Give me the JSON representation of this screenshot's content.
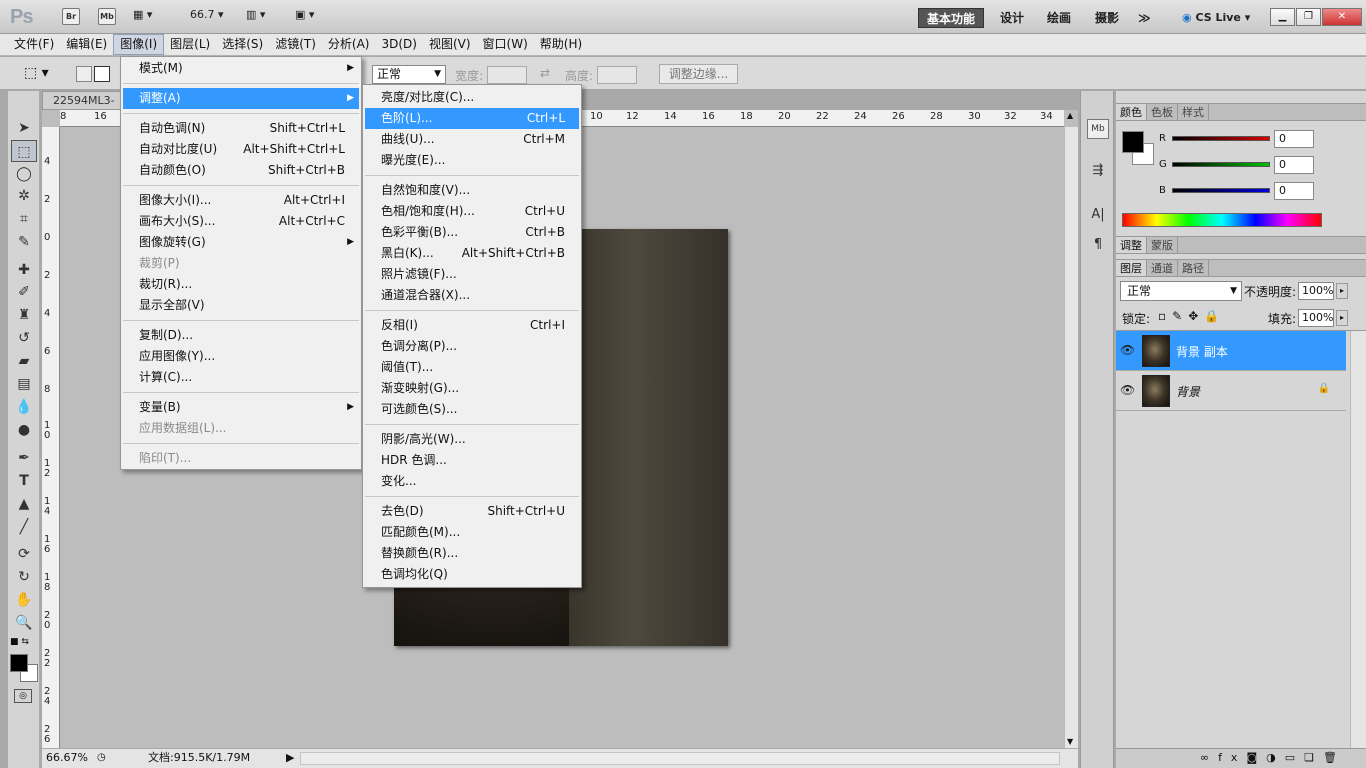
{
  "app": {
    "logo": "Ps",
    "bridge": "Br",
    "minibridge": "Mb",
    "zoom": "66.7",
    "workspaces": [
      "基本功能",
      "设计",
      "绘画",
      "摄影"
    ],
    "more": "≫",
    "cs_live": "CS Live"
  },
  "menubar": [
    "文件(F)",
    "编辑(E)",
    "图像(I)",
    "图层(L)",
    "选择(S)",
    "滤镜(T)",
    "分析(A)",
    "3D(D)",
    "视图(V)",
    "窗口(W)",
    "帮助(H)"
  ],
  "options": {
    "style": "正常",
    "width_label": "宽度:",
    "height_label": "高度:",
    "refine": "调整边缘..."
  },
  "document": {
    "tab": "22594ML3-",
    "ruler_top": [
      "8",
      "16",
      "10",
      "12",
      "14",
      "16",
      "18",
      "20",
      "22",
      "24",
      "26",
      "28",
      "30",
      "32",
      "34"
    ],
    "ruler_left": [
      "4",
      "2",
      "0",
      "2",
      "4",
      "6",
      "8",
      "10",
      "12",
      "14",
      "16",
      "18",
      "20",
      "22",
      "24",
      "26"
    ],
    "zoom_status": "66.67%",
    "file_info": "文档:915.5K/1.79M"
  },
  "image_menu": [
    {
      "label": "模式(M)",
      "submenu": true
    },
    {
      "sep": true
    },
    {
      "label": "调整(A)",
      "submenu": true,
      "highlight": true
    },
    {
      "sep": true
    },
    {
      "label": "自动色调(N)",
      "shortcut": "Shift+Ctrl+L"
    },
    {
      "label": "自动对比度(U)",
      "shortcut": "Alt+Shift+Ctrl+L"
    },
    {
      "label": "自动颜色(O)",
      "shortcut": "Shift+Ctrl+B"
    },
    {
      "sep": true
    },
    {
      "label": "图像大小(I)...",
      "shortcut": "Alt+Ctrl+I"
    },
    {
      "label": "画布大小(S)...",
      "shortcut": "Alt+Ctrl+C"
    },
    {
      "label": "图像旋转(G)",
      "submenu": true
    },
    {
      "label": "裁剪(P)",
      "disabled": true
    },
    {
      "label": "裁切(R)..."
    },
    {
      "label": "显示全部(V)"
    },
    {
      "sep": true
    },
    {
      "label": "复制(D)..."
    },
    {
      "label": "应用图像(Y)..."
    },
    {
      "label": "计算(C)..."
    },
    {
      "sep": true
    },
    {
      "label": "变量(B)",
      "submenu": true
    },
    {
      "label": "应用数据组(L)...",
      "disabled": true
    },
    {
      "sep": true
    },
    {
      "label": "陷印(T)...",
      "disabled": true
    }
  ],
  "adjust_menu": [
    {
      "label": "亮度/对比度(C)..."
    },
    {
      "label": "色阶(L)...",
      "shortcut": "Ctrl+L",
      "highlight": true
    },
    {
      "label": "曲线(U)...",
      "shortcut": "Ctrl+M"
    },
    {
      "label": "曝光度(E)..."
    },
    {
      "sep": true
    },
    {
      "label": "自然饱和度(V)..."
    },
    {
      "label": "色相/饱和度(H)...",
      "shortcut": "Ctrl+U"
    },
    {
      "label": "色彩平衡(B)...",
      "shortcut": "Ctrl+B"
    },
    {
      "label": "黑白(K)...",
      "shortcut": "Alt+Shift+Ctrl+B"
    },
    {
      "label": "照片滤镜(F)..."
    },
    {
      "label": "通道混合器(X)..."
    },
    {
      "sep": true
    },
    {
      "label": "反相(I)",
      "shortcut": "Ctrl+I"
    },
    {
      "label": "色调分离(P)..."
    },
    {
      "label": "阈值(T)..."
    },
    {
      "label": "渐变映射(G)..."
    },
    {
      "label": "可选颜色(S)..."
    },
    {
      "sep": true
    },
    {
      "label": "阴影/高光(W)..."
    },
    {
      "label": "HDR 色调..."
    },
    {
      "label": "变化..."
    },
    {
      "sep": true
    },
    {
      "label": "去色(D)",
      "shortcut": "Shift+Ctrl+U"
    },
    {
      "label": "匹配颜色(M)..."
    },
    {
      "label": "替换颜色(R)..."
    },
    {
      "label": "色调均化(Q)"
    }
  ],
  "color_panel": {
    "tabs": [
      "颜色",
      "色板",
      "样式"
    ],
    "channels": [
      {
        "label": "R",
        "value": "0",
        "color": "#e00000"
      },
      {
        "label": "G",
        "value": "0",
        "color": "#00c000"
      },
      {
        "label": "B",
        "value": "0",
        "color": "#0000e0"
      }
    ]
  },
  "adjust_tabs": [
    "调整",
    "蒙版"
  ],
  "layers_panel": {
    "tabs": [
      "图层",
      "通道",
      "路径"
    ],
    "blend_mode": "正常",
    "opacity_label": "不透明度:",
    "opacity": "100%",
    "lock_label": "锁定:",
    "fill_label": "填充:",
    "fill": "100%",
    "layers": [
      {
        "name": "背景 副本",
        "selected": true
      },
      {
        "name": "背景",
        "locked": true
      }
    ]
  }
}
